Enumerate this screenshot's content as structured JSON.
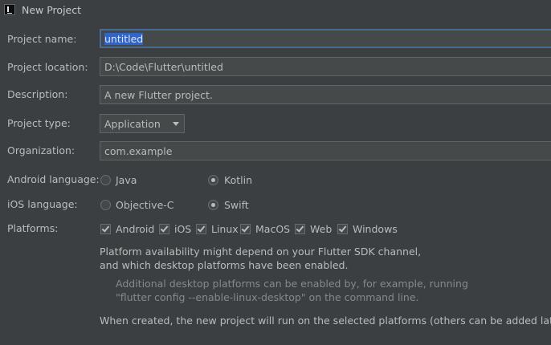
{
  "window": {
    "title": "New Project"
  },
  "form": {
    "name_label": "Project name:",
    "name_value": "untitled",
    "location_label": "Project location:",
    "location_value": "D:\\Code\\Flutter\\untitled",
    "description_label": "Description:",
    "description_value": "A new Flutter project.",
    "type_label": "Project type:",
    "type_value": "Application",
    "organization_label": "Organization:",
    "organization_value": "com.example",
    "android_label": "Android language:",
    "android_options": [
      "Java",
      "Kotlin"
    ],
    "android_selected": "Kotlin",
    "ios_label": "iOS language:",
    "ios_options": [
      "Objective-C",
      "Swift"
    ],
    "ios_selected": "Swift",
    "platforms_label": "Platforms:",
    "platforms": [
      {
        "label": "Android",
        "checked": true
      },
      {
        "label": "iOS",
        "checked": true
      },
      {
        "label": "Linux",
        "checked": true
      },
      {
        "label": "MacOS",
        "checked": true
      },
      {
        "label": "Web",
        "checked": true
      },
      {
        "label": "Windows",
        "checked": true
      }
    ]
  },
  "info": {
    "line1": "Platform availability might depend on your Flutter SDK channel,",
    "line2": "and which desktop platforms have been enabled.",
    "hint1": "Additional desktop platforms can be enabled by, for example, running",
    "hint2": "\"flutter config --enable-linux-desktop\" on the command line.",
    "footer": "When created, the new project will run on the selected platforms (others can be added later)."
  },
  "colors": {
    "background": "#3c3f41",
    "text": "#bbbbbb",
    "field_bg": "#45494a",
    "focus_border": "#466d94",
    "selection": "#2f65ca"
  }
}
